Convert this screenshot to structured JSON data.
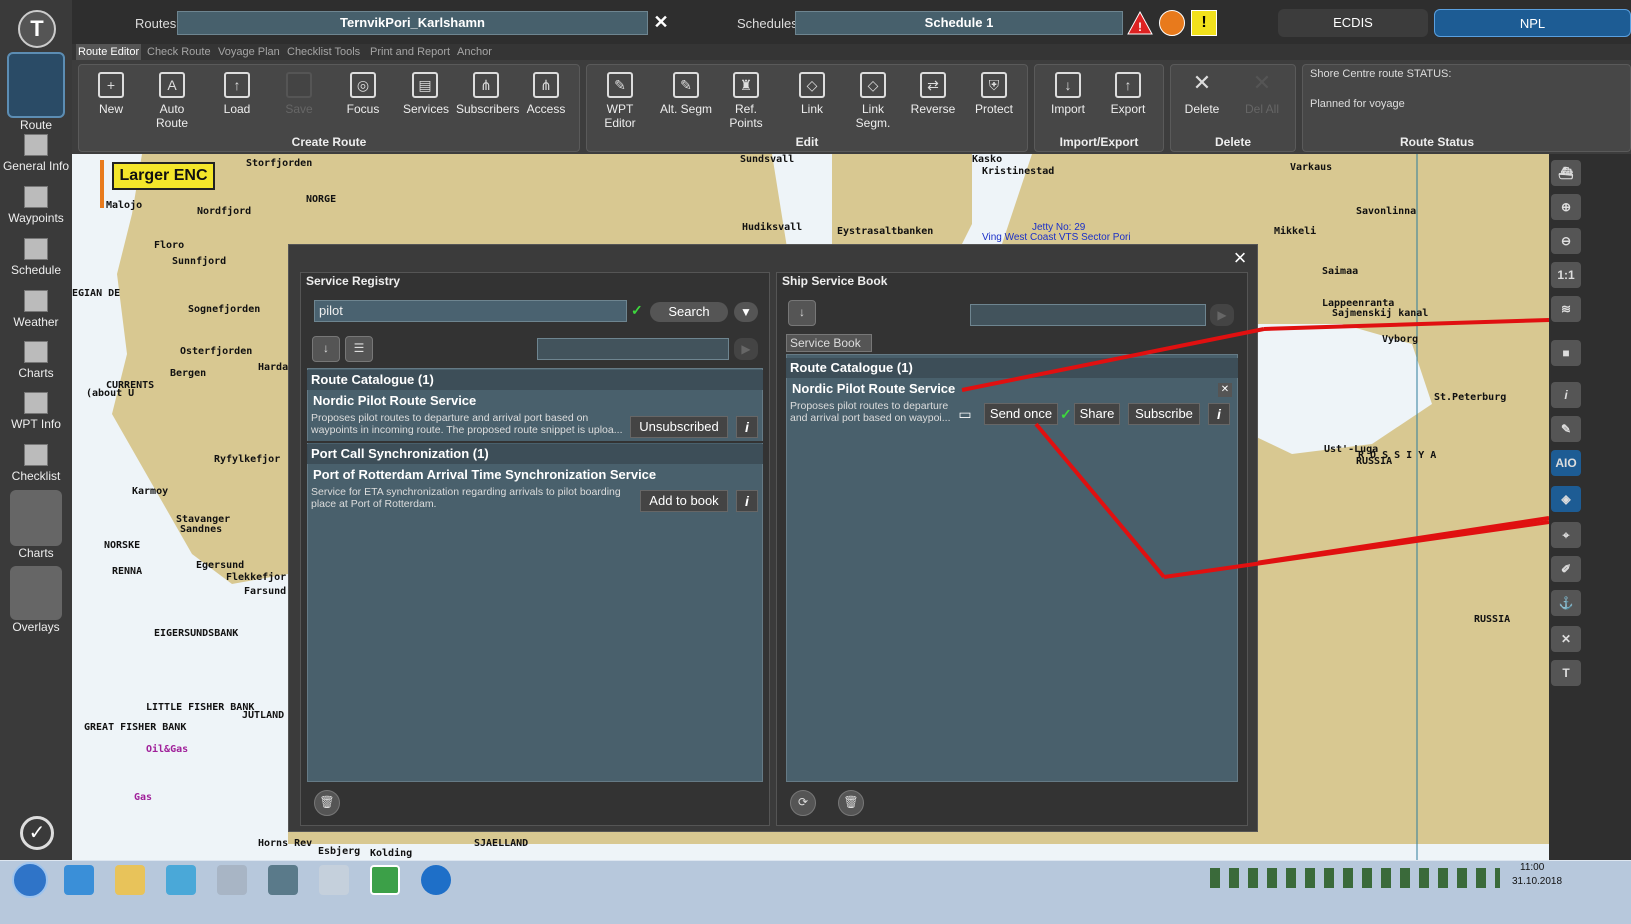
{
  "topbar": {
    "routes_label": "Routes:",
    "route_name": "TernvikPori_Karlshamn",
    "schedules_label": "Schedules:",
    "schedule_name": "Schedule 1",
    "ecdis_label": "ECDIS",
    "npl_label": "NPL"
  },
  "tabs": [
    "Route Editor",
    "Check Route",
    "Voyage Plan",
    "Checklist Tools",
    "Print and Report",
    "Anchor"
  ],
  "toolbar": {
    "create": {
      "title": "Create Route",
      "buttons": [
        "New",
        "Auto Route",
        "Load",
        "Save",
        "Focus",
        "Services",
        "Subscribers",
        "Access"
      ]
    },
    "edit": {
      "title": "Edit",
      "buttons": [
        "WPT Editor",
        "Alt. Segm",
        "Ref. Points",
        "Link",
        "Link Segm.",
        "Reverse",
        "Protect"
      ]
    },
    "io": {
      "title": "Import/Export",
      "buttons": [
        "Import",
        "Export"
      ]
    },
    "delete": {
      "title": "Delete",
      "buttons": [
        "Delete",
        "Del All"
      ]
    },
    "status": {
      "title": "Route Status",
      "line1": "Shore Centre route STATUS:",
      "line2": "Planned for voyage"
    }
  },
  "sidebar": [
    "Route",
    "General Info",
    "Waypoints",
    "Schedule",
    "Weather",
    "Charts",
    "WPT Info",
    "Checklist",
    "Charts",
    "Overlays"
  ],
  "map": {
    "larger_enc": "Larger ENC",
    "labels": [
      "Storfjorden",
      "NORGE",
      "Nordfjord",
      "Floro",
      "Sunnfjord",
      "Sognefjorden",
      "Osterfjorden",
      "Hardanger",
      "Bergen",
      "CURRENTS",
      "(about U",
      "Ryfylkefjor",
      "Karmoy",
      "Stavanger",
      "Sandnes",
      "NORSKE",
      "RENNA",
      "Egersund",
      "Flekkefjor",
      "Farsund",
      "EIGERSUNDSBANK",
      "LITTLE FISHER BANK",
      "JUTLAND",
      "GREAT FISHER BANK",
      "Oil&Gas",
      "Gas",
      "Horns Rev",
      "Esbjerg",
      "Kolding",
      "SJAELLAND",
      "Sundsvall",
      "Hudiksvall",
      "Kasko",
      "Kristinestad",
      "Eystrasaltbanken",
      "Varkaus",
      "Savonlinna",
      "Mikkeli",
      "Saimaa",
      "Lappeenranta",
      "Sajmenskij kanal",
      "St.Peterburg",
      "Ust'-Luga",
      "R O S S I Y A",
      "RUSSIA",
      "RUSSIA",
      "Vyborg",
      "Malojo",
      "EGIAN DE",
      "Jetty No: 29",
      "Ving West Coast VTS Sector Pori"
    ]
  },
  "dialog": {
    "close": "×",
    "registry": {
      "title": "Service Registry",
      "search_value": "pilot",
      "search_button": "Search",
      "categories": [
        {
          "name": "Route Catalogue (1)",
          "service": "Nordic Pilot Route Service",
          "desc1": "Proposes pilot routes to departure and arrival port based on",
          "desc2": "waypoints in incoming route. The proposed route snippet is uploa...",
          "action": "Unsubscribed"
        },
        {
          "name": "Port Call Synchronization (1)",
          "service": "Port of Rotterdam Arrival Time Synchronization Service",
          "desc1": "Service for ETA synchronization regarding arrivals to pilot boarding",
          "desc2": "place at Port of Rotterdam.",
          "action": "Add to book"
        }
      ]
    },
    "book": {
      "title": "Ship Service Book",
      "tab": "Service Book",
      "category": "Route Catalogue (1)",
      "service": "Nordic Pilot Route Service",
      "desc1": "Proposes pilot routes to departure",
      "desc2": "and arrival port based on waypoi...",
      "send_once": "Send once",
      "share": "Share",
      "subscribe": "Subscribe"
    }
  },
  "taskbar": {
    "time": "11:00",
    "date": "31.10.2018"
  },
  "right_strip": [
    "1:1",
    "AIO"
  ]
}
